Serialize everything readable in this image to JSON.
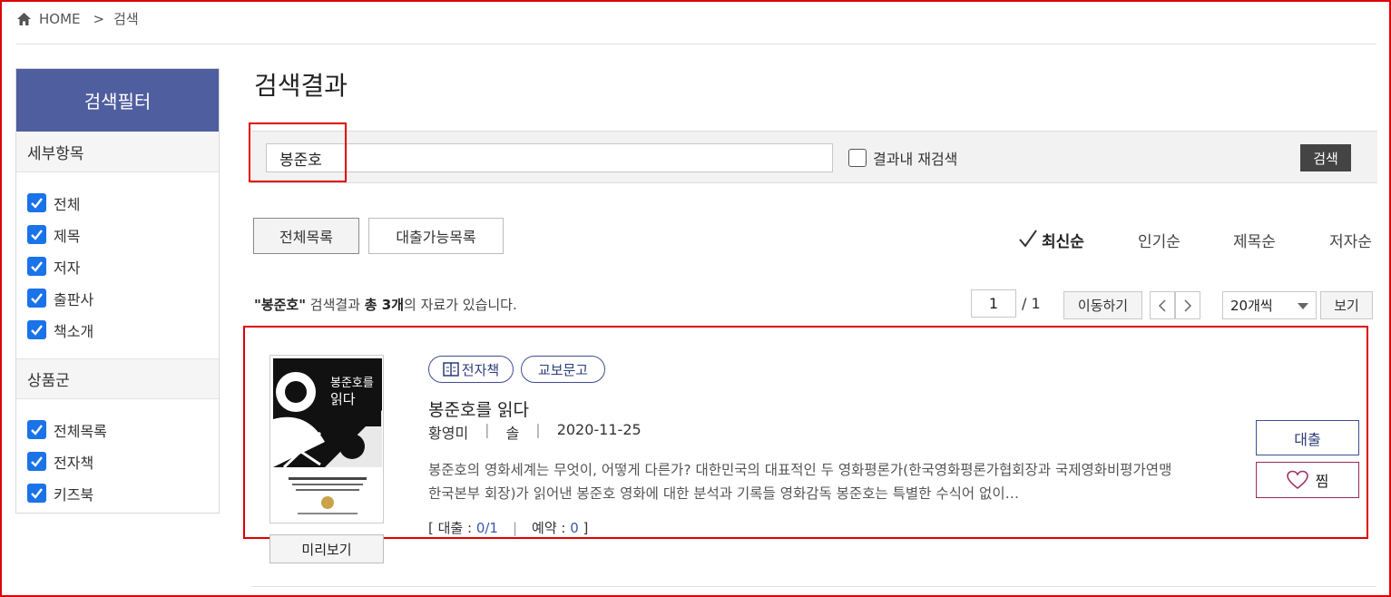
{
  "breadcrumb": {
    "home": "HOME",
    "separator": ">",
    "current": "검색"
  },
  "sidebar": {
    "title": "검색필터",
    "section1": {
      "title": "세부항목",
      "items": [
        "전체",
        "제목",
        "저자",
        "출판사",
        "책소개"
      ]
    },
    "section2": {
      "title": "상품군",
      "items": [
        "전체목록",
        "전자책",
        "키즈북"
      ]
    }
  },
  "main": {
    "title": "검색결과",
    "search": {
      "value": "봉준호",
      "re_search_label": "결과내 재검색",
      "button": "검색"
    },
    "tabs": [
      "전체목록",
      "대출가능목록"
    ],
    "sorts": [
      "최신순",
      "인기순",
      "제목순",
      "저자순"
    ],
    "count": {
      "query": "\"봉준호\"",
      "mid": " 검색결과 ",
      "total_label": "총 3개",
      "tail": "의 자료가 있습니다."
    },
    "pagination": {
      "current": "1",
      "total": "/ 1",
      "go_button": "이동하기",
      "per_page": "20개씩",
      "view_button": "보기"
    }
  },
  "result": {
    "tags": [
      "전자책",
      "교보문고"
    ],
    "title": "봉준호를 읽다",
    "author": "황영미",
    "publisher": "솔",
    "date": "2020-11-25",
    "description": "봉준호의 영화세계는 무엇이, 어떻게 다른가? 대한민국의 대표적인 두 영화평론가(한국영화평론가협회장과 국제영화비평가연맹 한국본부 회장)가 읽어낸 봉준호 영화에 대한 분석과 기록들 영화감독 봉준호는 특별한 수식어 없이…",
    "loan_label": "[ 대출 : ",
    "loan_value": "0/1",
    "reserve_label": "예약 : ",
    "reserve_value": "0",
    "close_bracket": " ]",
    "preview_button": "미리보기",
    "loan_button": "대출",
    "wish_button": "찜",
    "cover_title": "봉준호를 읽다"
  },
  "colors": {
    "sidebar_head": "#4f5e9e",
    "checkbox": "#1a73e8",
    "highlight": "#e00000",
    "accent": "#3d4f8f"
  }
}
